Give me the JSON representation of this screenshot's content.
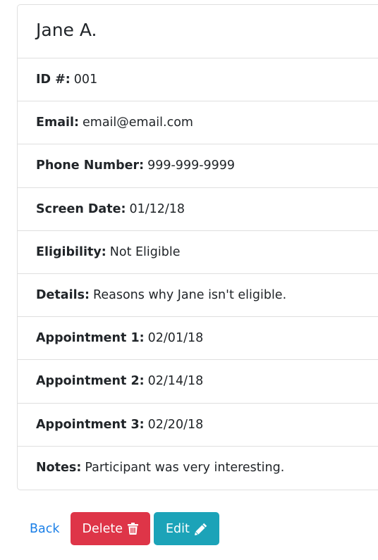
{
  "participant": {
    "name": "Jane A.",
    "fields": [
      {
        "key": "id",
        "label": "ID #:",
        "value": "001"
      },
      {
        "key": "email",
        "label": "Email:",
        "value": "email@email.com"
      },
      {
        "key": "phone",
        "label": "Phone Number:",
        "value": "999-999-9999"
      },
      {
        "key": "screen_date",
        "label": "Screen Date:",
        "value": "01/12/18"
      },
      {
        "key": "eligibility",
        "label": "Eligibility:",
        "value": "Not Eligible"
      },
      {
        "key": "details",
        "label": "Details:",
        "value": "Reasons why Jane isn't eligible."
      },
      {
        "key": "appointment_1",
        "label": "Appointment 1:",
        "value": "02/01/18"
      },
      {
        "key": "appointment_2",
        "label": "Appointment 2:",
        "value": "02/14/18"
      },
      {
        "key": "appointment_3",
        "label": "Appointment 3:",
        "value": "02/20/18"
      },
      {
        "key": "notes",
        "label": "Notes:",
        "value": "Participant was very interesting."
      }
    ]
  },
  "actions": {
    "back_label": "Back",
    "delete_label": "Delete",
    "delete_icon": "trash-icon",
    "edit_label": "Edit",
    "edit_icon": "pencil-icon"
  },
  "colors": {
    "link": "#1a7fe7",
    "danger": "#de3548",
    "info": "#1ca3b8",
    "border": "#dfdfdf"
  }
}
